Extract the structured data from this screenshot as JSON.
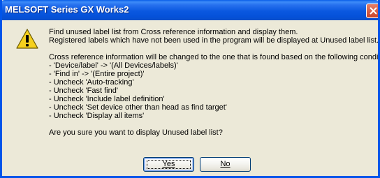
{
  "window": {
    "title": "MELSOFT Series GX Works2"
  },
  "icons": {
    "warning": "warning-triangle-icon",
    "close": "close-icon"
  },
  "message": {
    "intro": [
      "Find unused label list from Cross reference information and display them.",
      "Registered labels which have not been used in the program will be displayed at Unused label list."
    ],
    "conditions": [
      "Cross reference information will be changed to the one that is found based on the following conditions.",
      "- 'Device/label' -> '(All Devices/labels)'",
      "- 'Find in' -> '(Entire project)'",
      "- Uncheck 'Auto-tracking'",
      "- Uncheck 'Fast find'",
      "- Uncheck 'Include label definition'",
      "- Uncheck 'Set device other than head as find target'",
      "- Uncheck 'Display all items'"
    ],
    "question": "Are you sure you want to display Unused label list?"
  },
  "buttons": {
    "yes": "Yes",
    "no": "No"
  },
  "colors": {
    "titlebar": "#0450d8",
    "background": "#ece9d8",
    "close": "#c8432a",
    "warning": "#f5d01e"
  }
}
